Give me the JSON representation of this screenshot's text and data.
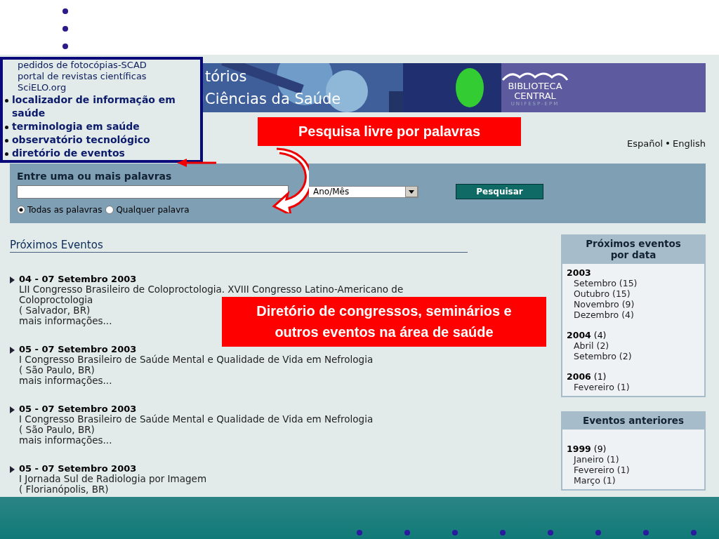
{
  "banner": {
    "title_lines": [
      "tórios",
      "Ciências da Saúde"
    ],
    "library": {
      "line1": "BIBLIOTECA",
      "line2": "CENTRAL",
      "line3": "UNIFESP-EPM"
    }
  },
  "languages": [
    "Español",
    "English"
  ],
  "search": {
    "prompt": "Entre uma ou mais palavras",
    "date_select": "Ano/Mês",
    "button": "Pesquisar",
    "options": [
      {
        "label": "Todas as palavras",
        "selected": true
      },
      {
        "label": "Qualquer palavra",
        "selected": false
      }
    ]
  },
  "events": {
    "heading": "Próximos Eventos",
    "items": [
      {
        "date": "04 - 07 Setembro 2003",
        "title": "LII Congresso Brasileiro de Coloproctologia. XVIII Congresso Latino-Americano de Coloproctologia",
        "place": "( Salvador, BR)",
        "link": "mais informações..."
      },
      {
        "date": "05 - 07 Setembro 2003",
        "title": "I Congresso Brasileiro de Saúde Mental e Qualidade de Vida em Nefrologia",
        "place": "( São Paulo, BR)",
        "link": "mais informações..."
      },
      {
        "date": "05 - 07 Setembro 2003",
        "title": "I Congresso Brasileiro de Saúde Mental e Qualidade de Vida em Nefrologia",
        "place": "( São Paulo, BR)",
        "link": "mais informações..."
      },
      {
        "date": "05 - 07 Setembro 2003",
        "title": "I Jornada Sul de Radiologia por Imagem",
        "place": "( Florianópolis, BR)"
      }
    ]
  },
  "sidebar": [
    {
      "heading": "Próximos eventos por data",
      "years": [
        {
          "year": "2003",
          "months": [
            "Setembro (15)",
            "Outubro (15)",
            "Novembro (9)",
            "Dezembro (4)"
          ]
        },
        {
          "year": "2004",
          "count": "(4)",
          "months": [
            "Abril (2)",
            "Setembro (2)"
          ]
        },
        {
          "year": "2006",
          "count": "(1)",
          "months": [
            "Fevereiro (1)"
          ]
        }
      ]
    },
    {
      "heading": "Eventos anteriores",
      "years": [
        {
          "year": "1999",
          "count": "(9)",
          "months": [
            "Janeiro (1)",
            "Fevereiro (1)",
            "Março (1)"
          ]
        }
      ]
    }
  ],
  "overlay_menu": {
    "plain": [
      "pedidos de fotocópias-SCAD",
      "portal de revistas científicas",
      "SciELO.org"
    ],
    "bullets": [
      "localizador de informação em saúde",
      "terminologia em saúde",
      "observatório tecnológico",
      "diretório de eventos"
    ]
  },
  "callouts": [
    "Pesquisa livre por palavras",
    "Diretório de congressos, seminários e outros eventos na área de saúde"
  ]
}
